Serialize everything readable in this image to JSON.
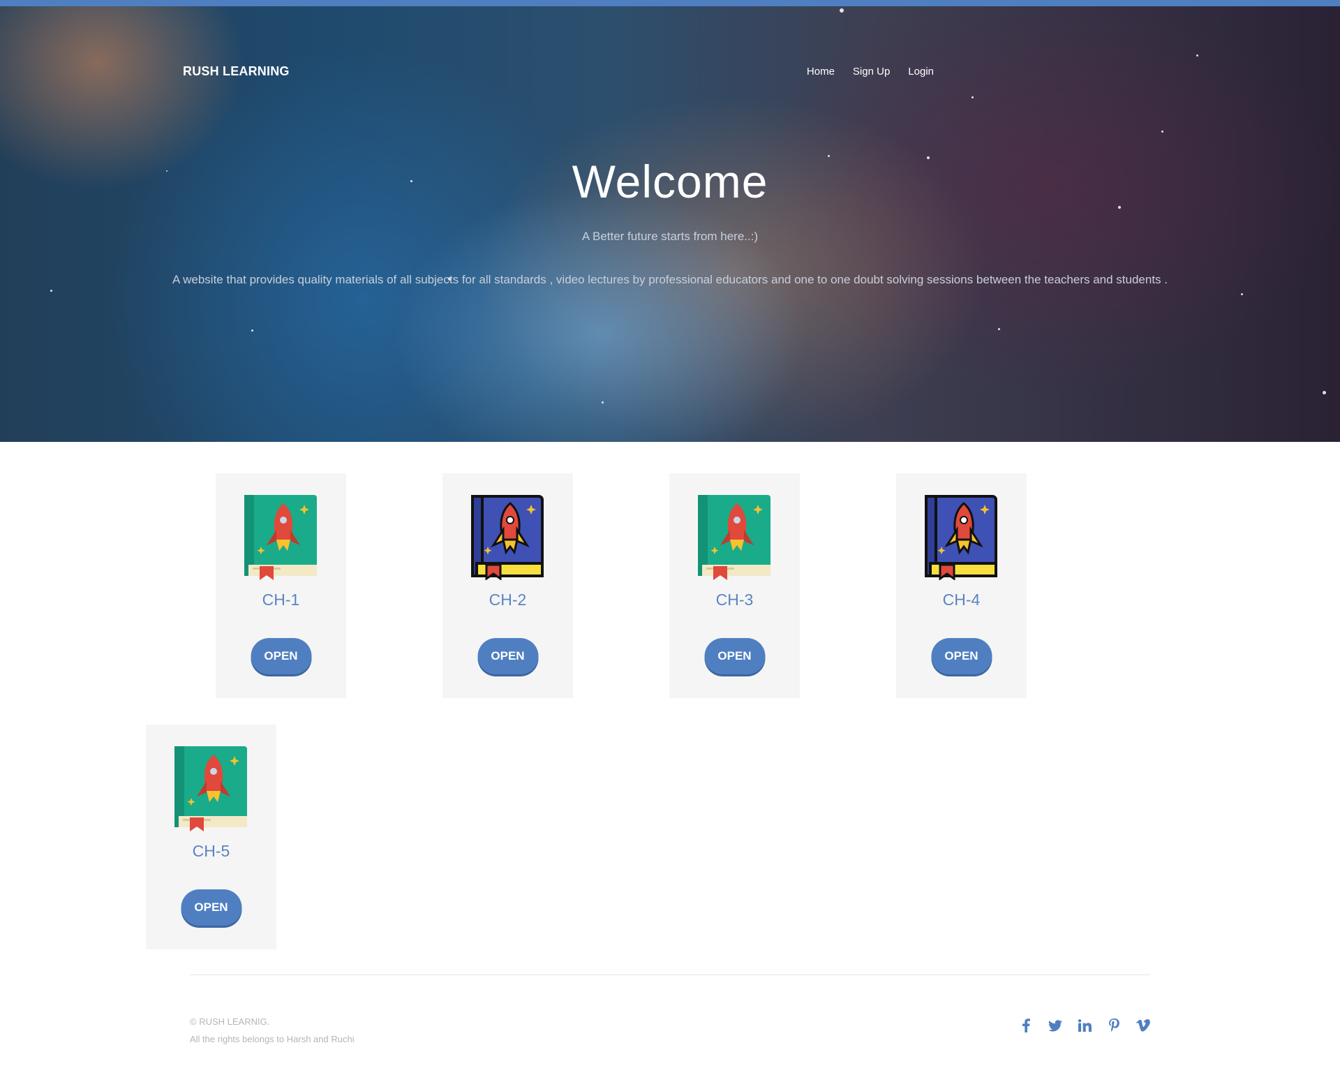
{
  "brand": "RUSH LEARNING",
  "nav": {
    "home": "Home",
    "signup": "Sign Up",
    "login": "Login"
  },
  "hero": {
    "title": "Welcome",
    "subtitle": "A Better future starts from here..:)",
    "description": "A website that provides quality materials of all subjects for all standards , video lectures by professional educators and one to one doubt solving sessions between the teachers and students ."
  },
  "cards": [
    {
      "title": "CH-1",
      "button": "OPEN",
      "icon": "green-rocket-book-icon"
    },
    {
      "title": "CH-2",
      "button": "OPEN",
      "icon": "blue-rocket-book-icon"
    },
    {
      "title": "CH-3",
      "button": "OPEN",
      "icon": "green-rocket-book-icon"
    },
    {
      "title": "CH-4",
      "button": "OPEN",
      "icon": "blue-rocket-book-icon"
    },
    {
      "title": "CH-5",
      "button": "OPEN",
      "icon": "green-rocket-book-icon"
    }
  ],
  "footer": {
    "copyright": "© RUSH LEARNIG.",
    "rights": "All the rights belongs to Harsh and Ruchi",
    "social": [
      "facebook-icon",
      "twitter-icon",
      "linkedin-icon",
      "pinterest-icon",
      "vimeo-icon"
    ]
  },
  "colors": {
    "accent": "#4f7fc1",
    "card_bg": "#f5f5f5",
    "card_title": "#5b84c4",
    "footer_text": "#b5b5b5"
  }
}
